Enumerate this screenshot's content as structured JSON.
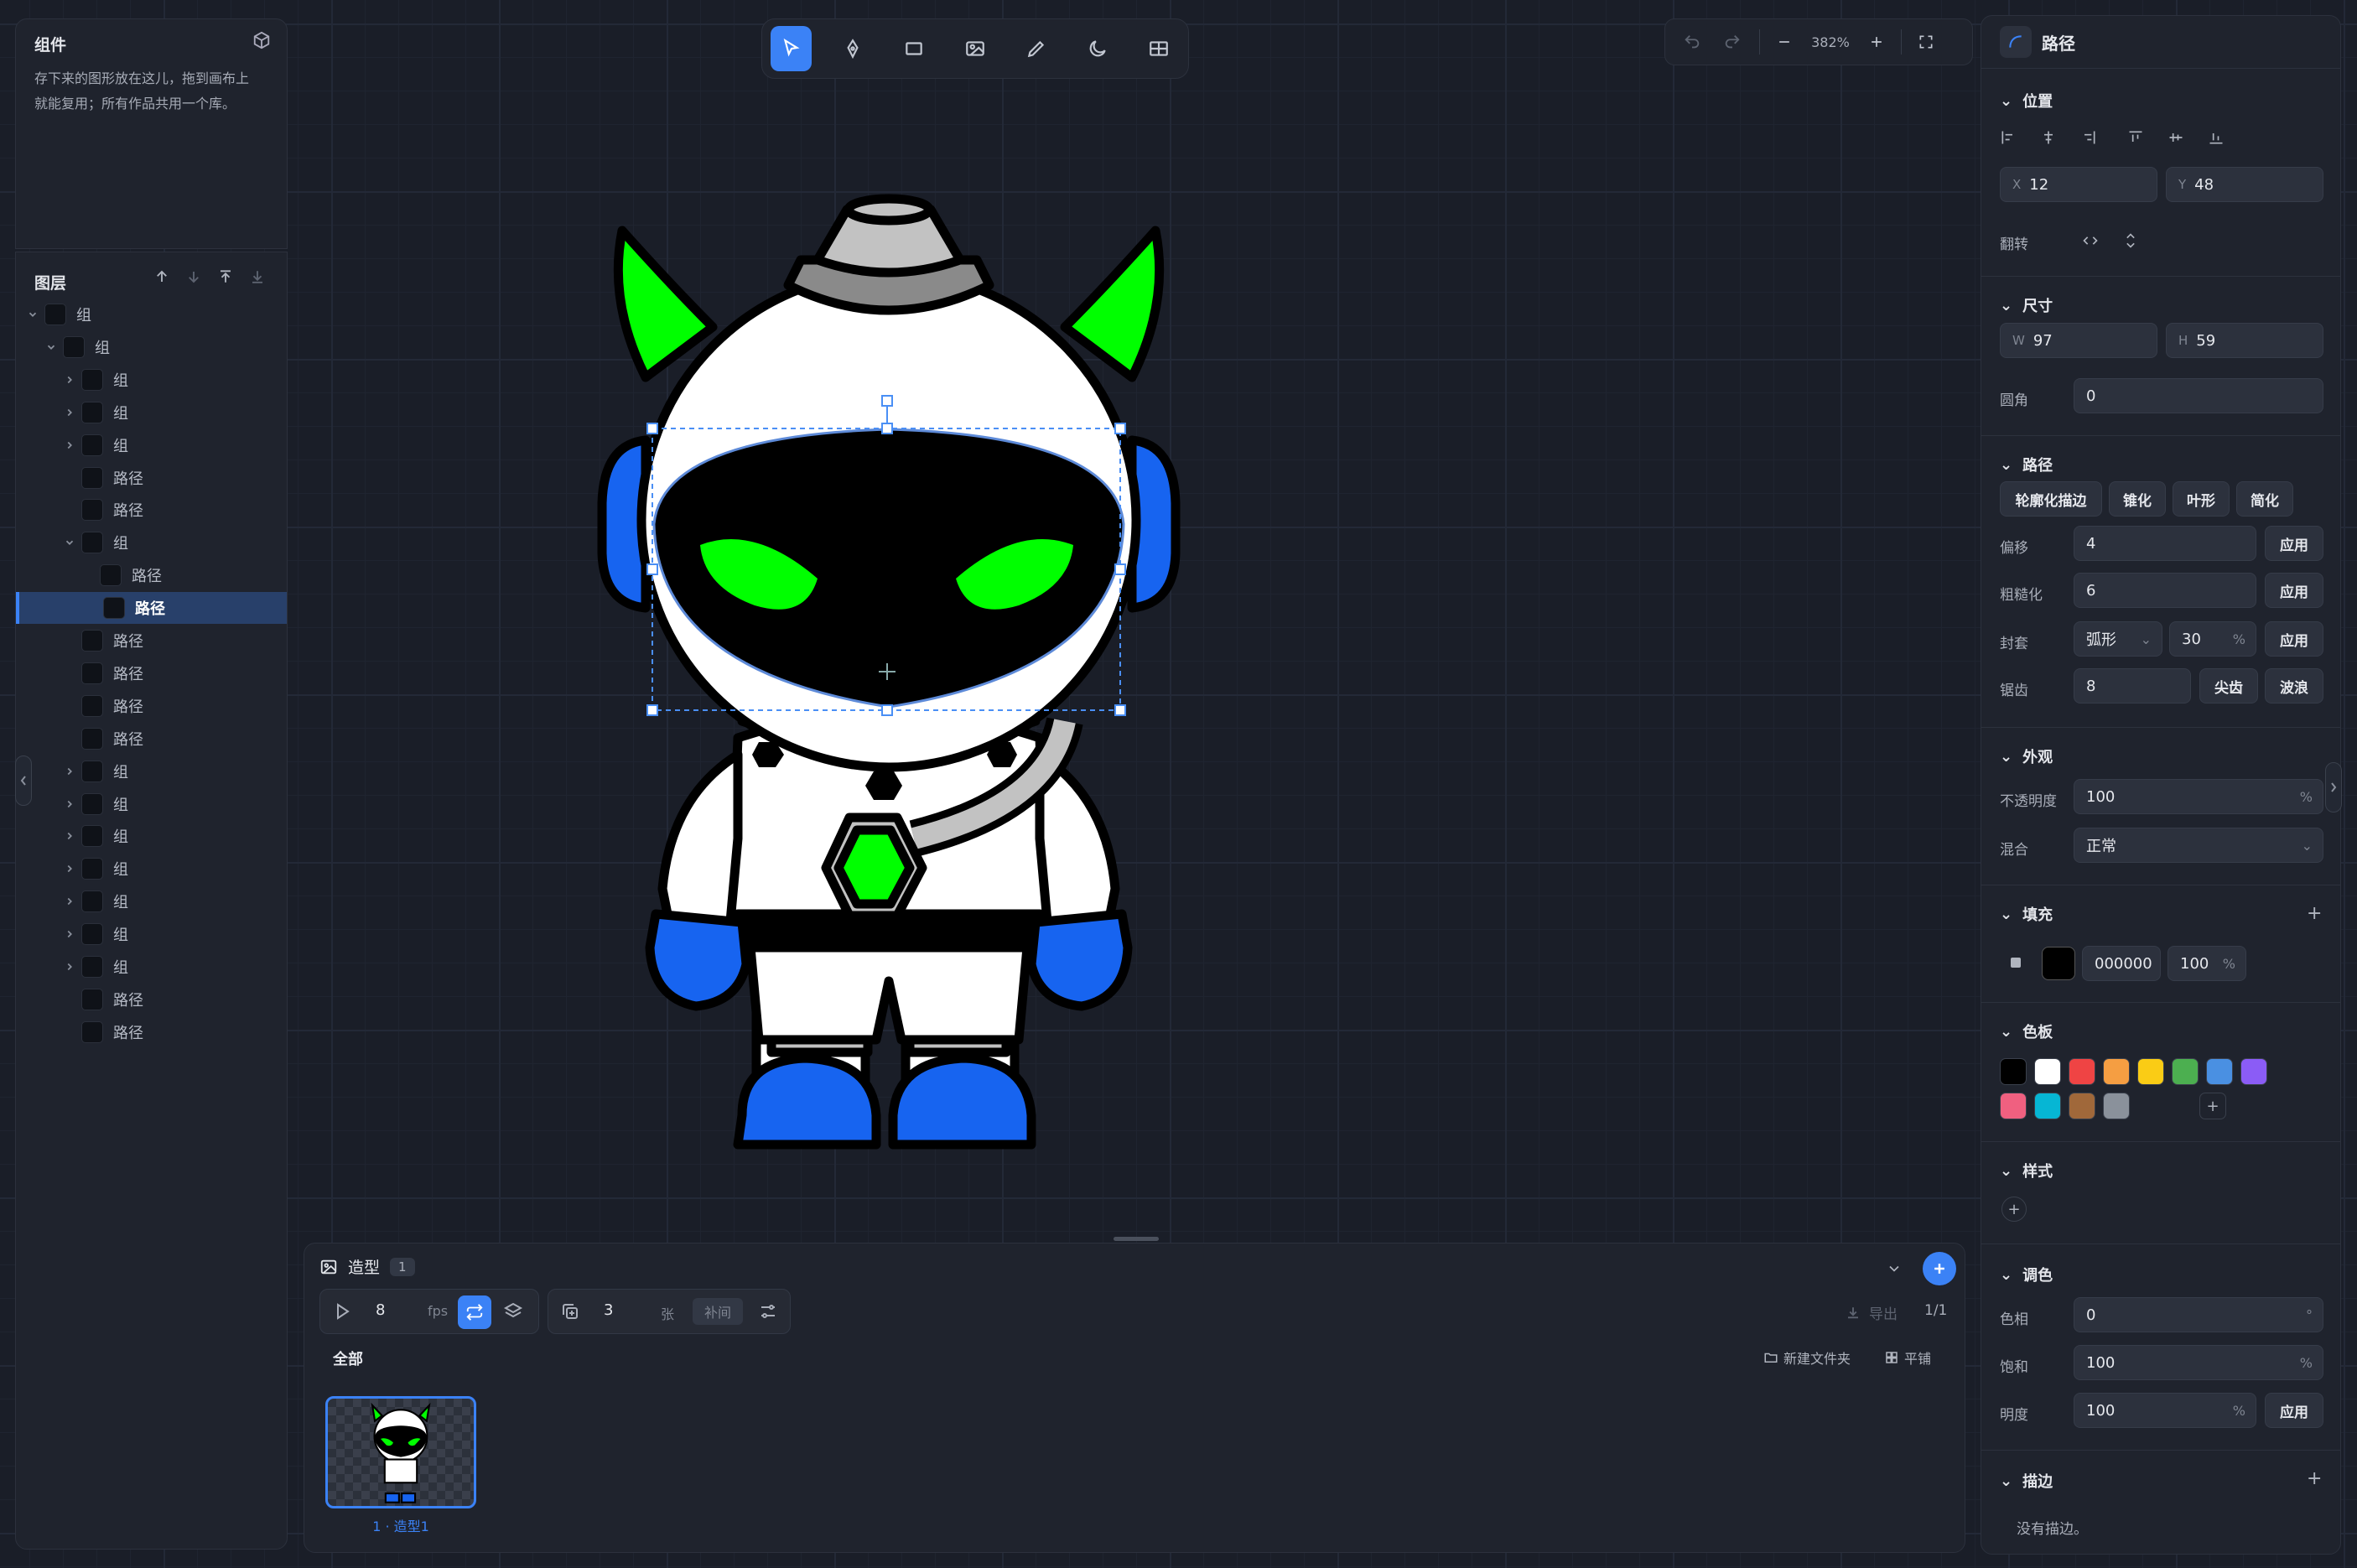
{
  "left": {
    "title": "组件",
    "desc_line1": "存下来的图形放在这儿，拖到画布上",
    "desc_line2": "就能复用；所有作品共用一个库。",
    "layers_title": "图层",
    "layers": [
      "组",
      "组",
      "组",
      "组",
      "组",
      "路径",
      "路径",
      "组",
      "路径",
      "路径",
      "路径",
      "路径",
      "路径",
      "路径",
      "组",
      "组",
      "组",
      "组",
      "组",
      "组",
      "组",
      "路径",
      "路径"
    ]
  },
  "toolbar": {
    "tools": [
      "select-tool",
      "pen-tool",
      "rect-tool",
      "image-tool",
      "pencil-tool",
      "moon-tool",
      "table-tool"
    ]
  },
  "view": {
    "zoom": "382%"
  },
  "right": {
    "title": "路径",
    "position": {
      "title": "位置",
      "x_label": "X",
      "x": "12",
      "y_label": "Y",
      "y": "48",
      "flip": "翻转"
    },
    "size": {
      "title": "尺寸",
      "w_label": "W",
      "w": "97",
      "h_label": "H",
      "h": "59",
      "radius_label": "圆角",
      "radius": "0"
    },
    "path": {
      "title": "路径",
      "ops": [
        "轮廓化描边",
        "锥化",
        "叶形",
        "简化"
      ],
      "offset_label": "偏移",
      "offset": "4",
      "rough_label": "粗糙化",
      "rough": "6",
      "envelope_label": "封套",
      "envelope_mode": "弧形",
      "envelope_val": "30",
      "pct": "%",
      "teeth_label": "锯齿",
      "teeth": "8",
      "sharp": "尖齿",
      "wave": "波浪",
      "apply": "应用"
    },
    "appearance": {
      "title": "外观",
      "opacity_label": "不透明度",
      "opacity": "100",
      "blend_label": "混合",
      "blend": "正常"
    },
    "fill": {
      "title": "填充",
      "hex": "000000",
      "opacity": "100"
    },
    "palette": {
      "title": "色板",
      "colors": [
        "#000000",
        "#ffffff",
        "#ef4444",
        "#f59e42",
        "#facc15",
        "#4caf50",
        "#4a90e2",
        "#8b5cf6",
        "#f06080",
        "#06b6d4",
        "#a0683a",
        "#8a919b"
      ]
    },
    "style": {
      "title": "样式"
    },
    "tone": {
      "title": "调色",
      "hue_label": "色相",
      "hue": "0",
      "hue_suf": "°",
      "sat_label": "饱和",
      "sat": "100",
      "light_label": "明度",
      "light": "100"
    },
    "stroke": {
      "title": "描边",
      "empty": "没有描边。"
    }
  },
  "bottom": {
    "title": "造型",
    "count": "1",
    "fps": "8",
    "fps_label": "fps",
    "frames": "3",
    "frames_label": "张",
    "tween": "补间",
    "export": "导出",
    "page": "1/1",
    "all": "全部",
    "new_folder": "新建文件夹",
    "tile": "平铺",
    "costume_label": "1 · 造型1"
  }
}
